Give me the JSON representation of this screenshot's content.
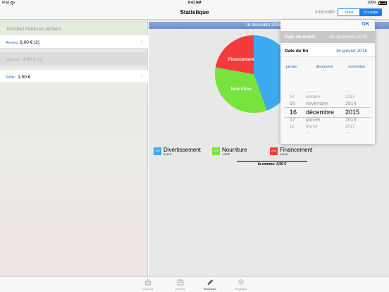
{
  "status_bar": {
    "device": "iPad",
    "wifi_icon": "wifi-icon",
    "time": "9:41 AM",
    "battery": "100%"
  },
  "nav": {
    "title": "Statistique",
    "intervalle_label": "Intervalle",
    "segments": [
      "Stripe",
      "Circulaire"
    ],
    "selected_segment": "Circulaire"
  },
  "sidebar": {
    "header": "TOUCHEZ POUR LES DÉTAILS:",
    "rows": [
      {
        "label": "Revenu",
        "value": "6,00 € (2)",
        "dimmed": false
      },
      {
        "label": "Dépense:",
        "value": "4,50 € (3)",
        "dimmed": true
      },
      {
        "label": "Solde:",
        "value": "1,50 €",
        "dimmed": false
      }
    ]
  },
  "date_header": "16 décembre 2015 — 16",
  "chart_data": {
    "type": "pie",
    "slices": [
      {
        "name": "Divertissement",
        "percent": 44,
        "amount": "2,00 €",
        "color": "#3ca9f2",
        "label": ""
      },
      {
        "name": "Nourriture",
        "percent": 33,
        "amount": "1,50 €",
        "color": "#77e33c",
        "label": "Nourriture"
      },
      {
        "name": "Financement",
        "percent": 22,
        "amount": "1,00 €",
        "color": "#f43b3b",
        "label": "Financement"
      }
    ],
    "legend_placement": "bottom"
  },
  "legend": {
    "items": [
      {
        "badge": "44%",
        "name": "Divertissement",
        "amount": "2,00 €",
        "color": "#3ca9f2"
      },
      {
        "badge": "33%",
        "name": "Nourriture",
        "amount": "1,50 €",
        "color": "#77e33c"
      },
      {
        "badge": "22%",
        "name": "Financement",
        "amount": "1,00 €",
        "color": "#f43b3b"
      }
    ],
    "sum": "la somme: 4,50 €"
  },
  "popover": {
    "ok": "OK",
    "start_label": "Date de début",
    "start_value": "16 décembre 2015",
    "end_label": "Date de fin",
    "end_value": "16 janvier 2016",
    "months": [
      "janvier",
      "décembre",
      "novembre"
    ],
    "picker": {
      "days": [
        "13",
        "14",
        "15",
        "16",
        "17",
        "18",
        "19"
      ],
      "months": [
        "septembre",
        "octobre",
        "novembre",
        "décembre",
        "janvier",
        "février",
        "mars"
      ],
      "years": [
        "2012",
        "2013",
        "2014",
        "2015",
        "2016",
        "2017",
        "2018"
      ]
    }
  },
  "tabs": [
    {
      "label": "Dépense",
      "icon": "basket-icon"
    },
    {
      "label": "Revenu",
      "icon": "briefcase-icon"
    },
    {
      "label": "Statistique",
      "icon": "ruler-icon",
      "active": true
    },
    {
      "label": "Réglages",
      "icon": "gear-icon"
    }
  ]
}
